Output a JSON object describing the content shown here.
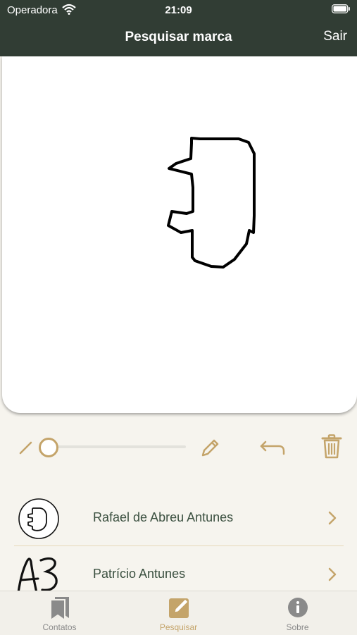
{
  "status_bar": {
    "carrier": "Operadora",
    "time": "21:09"
  },
  "nav": {
    "title": "Pesquisar marca",
    "right_button": "Sair"
  },
  "toolbar": {
    "brush_size_level": 0,
    "icons": [
      "thin-pencil-icon",
      "brush-size-slider",
      "pencil-icon",
      "undo-icon",
      "trash-icon"
    ]
  },
  "results": [
    {
      "name": "Rafael de Abreu Antunes"
    },
    {
      "name": "Patrício Antunes"
    }
  ],
  "tabs": [
    {
      "label": "Contatos",
      "icon": "bookmarks-icon"
    },
    {
      "label": "Pesquisar",
      "icon": "edit-icon",
      "active": true
    },
    {
      "label": "Sobre",
      "icon": "info-icon"
    }
  ],
  "colors": {
    "header": "#313d34",
    "accent": "#c4a46a",
    "list_text": "#3b5040"
  }
}
